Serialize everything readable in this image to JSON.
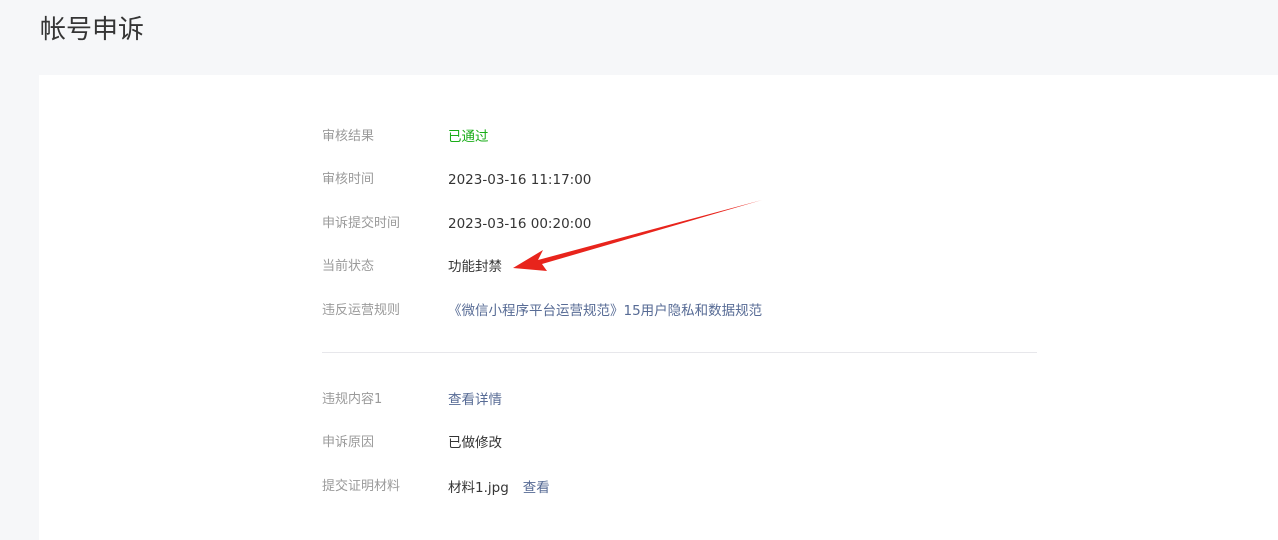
{
  "page": {
    "title": "帐号申诉"
  },
  "details": {
    "review_result_label": "审核结果",
    "review_result_value": "已通过",
    "review_time_label": "审核时间",
    "review_time_value": "2023-03-16 11:17:00",
    "submit_time_label": "申诉提交时间",
    "submit_time_value": "2023-03-16 00:20:00",
    "status_label": "当前状态",
    "status_value": "功能封禁",
    "violation_rule_label": "违反运营规则",
    "violation_rule_value": "《微信小程序平台运营规范》15用户隐私和数据规范"
  },
  "appeal": {
    "violation_content_label": "违规内容1",
    "violation_content_link": "查看详情",
    "reason_label": "申诉原因",
    "reason_value": "已做修改",
    "materials_label": "提交证明材料",
    "material_file": "材料1.jpg",
    "material_view": "查看"
  },
  "colors": {
    "success": "#1aad19",
    "link": "#576b95",
    "annotation_arrow": "#e8241c"
  },
  "icons": {
    "annotation": "red-arrow-icon"
  }
}
